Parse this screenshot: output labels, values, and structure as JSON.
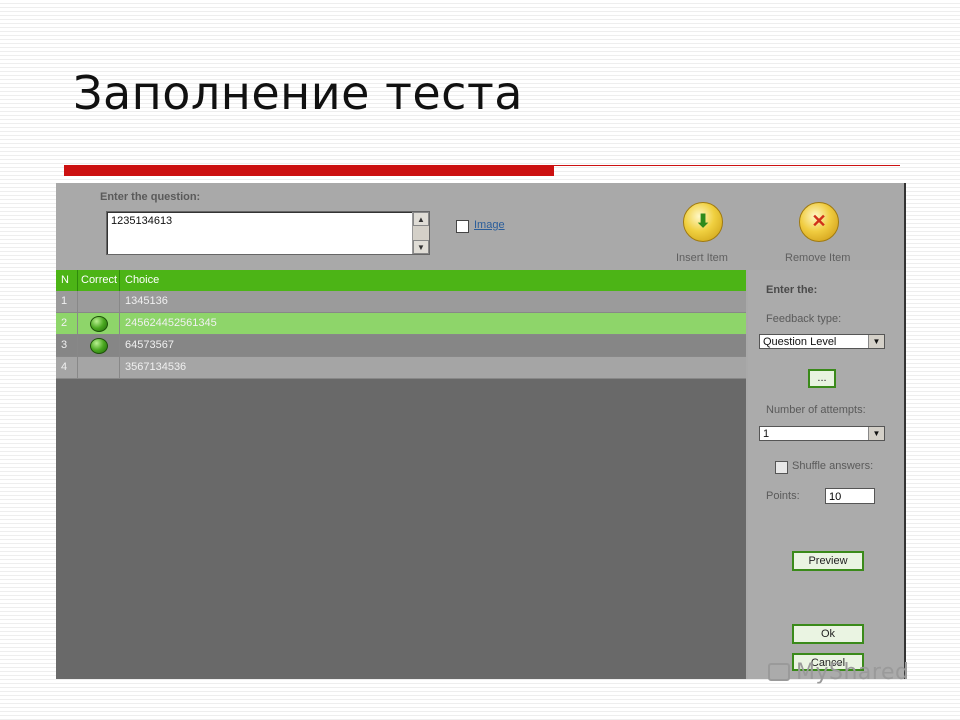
{
  "slide": {
    "title": "Заполнение теста",
    "accent_color": "#cc1111"
  },
  "question": {
    "label": "Enter the question:",
    "value": "1235134613",
    "image_label": "Image",
    "image_checked": false
  },
  "toolbar": {
    "insert_label": "Insert Item",
    "remove_label": "Remove Item",
    "insert_icon": "green-down-arrow-icon",
    "remove_icon": "red-x-icon"
  },
  "grid": {
    "header_color": "#4cb416",
    "columns": [
      "N",
      "Correct",
      "Choice"
    ],
    "rows": [
      {
        "n": "1",
        "correct": false,
        "choice": "1345136"
      },
      {
        "n": "2",
        "correct": true,
        "choice": "245624452561345",
        "selected": true
      },
      {
        "n": "3",
        "correct": true,
        "choice": "64573567"
      },
      {
        "n": "4",
        "correct": false,
        "choice": "3567134536"
      }
    ]
  },
  "panel": {
    "title": "Enter the:",
    "feedback_label": "Feedback type:",
    "feedback_value": "Question Level",
    "ellipsis_button": "...",
    "attempts_label": "Number of attempts:",
    "attempts_value": "1",
    "shuffle_label": "Shuffle answers:",
    "shuffle_checked": false,
    "points_label": "Points:",
    "points_value": "10",
    "preview_button": "Preview",
    "ok_button": "Ok",
    "cancel_button": "Cancel"
  },
  "watermark": {
    "text": "MyShared"
  }
}
